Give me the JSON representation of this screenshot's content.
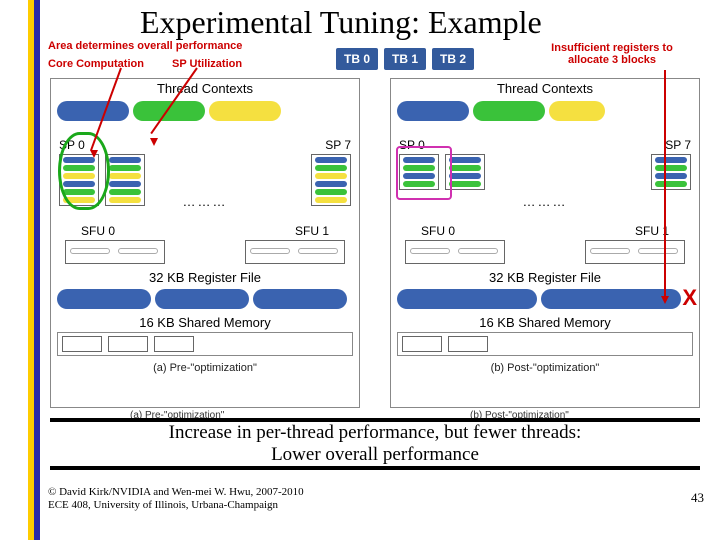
{
  "title": "Experimental Tuning: Example",
  "legend": {
    "area": "Area determines overall performance",
    "core_computation": "Core Computation",
    "sp_utilization": "SP Utilization"
  },
  "tb_badges": [
    "TB 0",
    "TB 1",
    "TB 2"
  ],
  "insufficient": "Insufficient registers to allocate 3 blocks",
  "panel": {
    "thread_contexts": "Thread Contexts",
    "sp0": "SP 0",
    "sp7": "SP 7",
    "dots": "………",
    "sfu0": "SFU 0",
    "sfu1": "SFU 1",
    "reg": "32 KB Register File",
    "shmem": "16 KB Shared Memory"
  },
  "captions": {
    "a": "(a) Pre-\"optimization\"",
    "b": "(b) Post-\"optimization\""
  },
  "x_mark": "X",
  "message_line1": "Increase in per-thread performance, but fewer threads:",
  "message_line2": "Lower overall performance",
  "copyright_line1": "© David Kirk/NVIDIA and Wen-mei W. Hwu, 2007-2010",
  "copyright_line2": "ECE 408, University of Illinois, Urbana-Champaign",
  "page_number": "43"
}
